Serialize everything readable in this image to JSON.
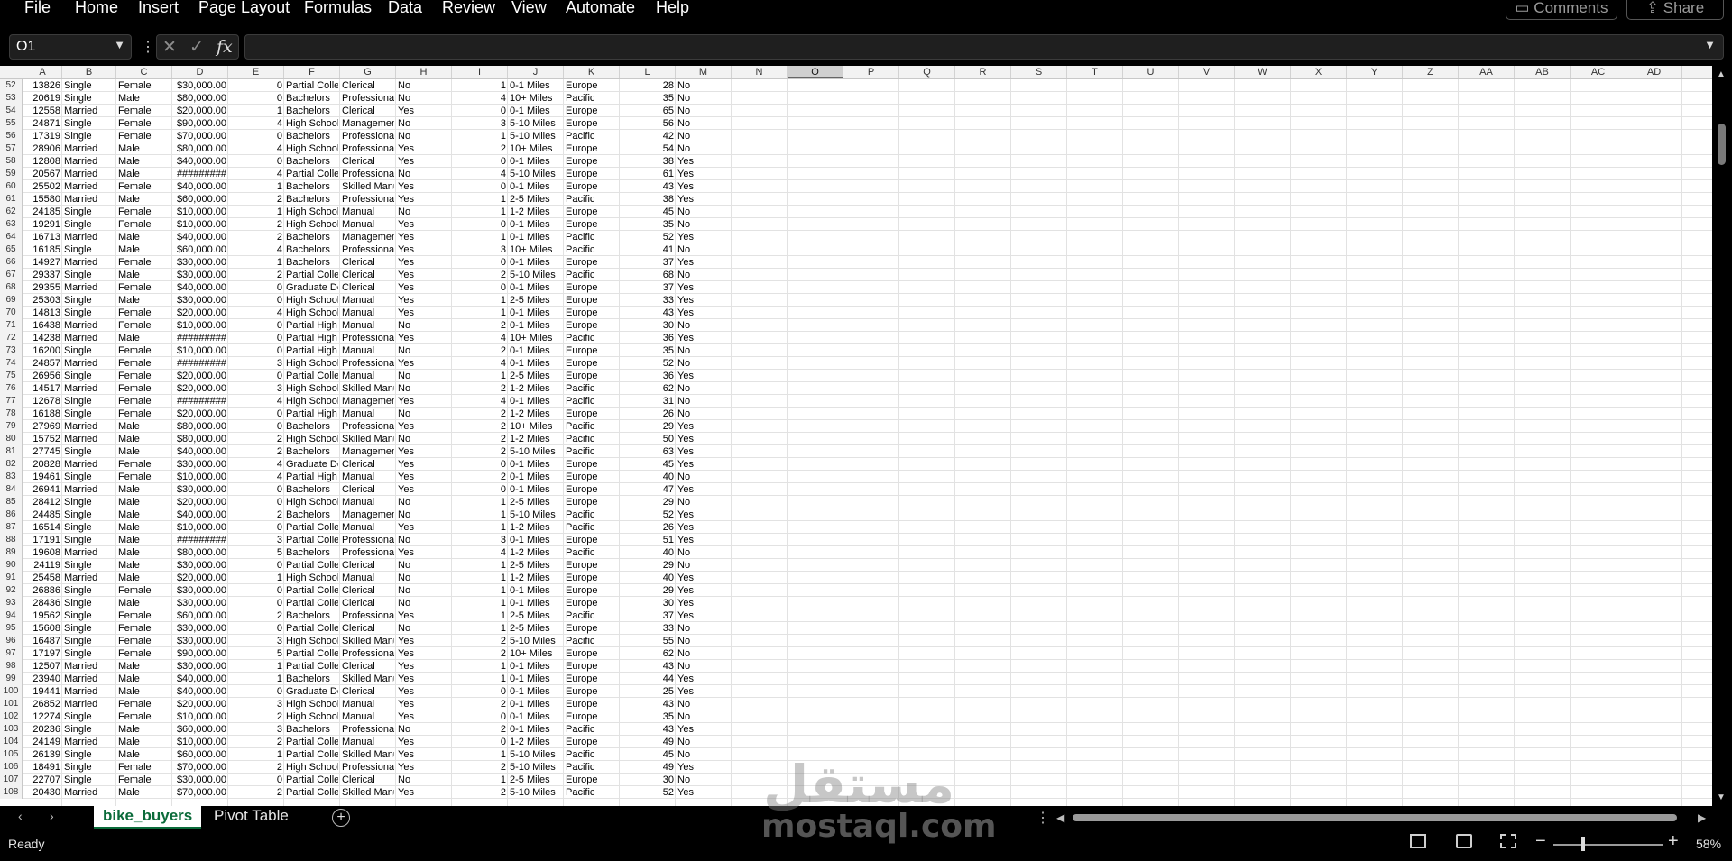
{
  "menu": [
    "File",
    "Home",
    "Insert",
    "Page Layout",
    "Formulas",
    "Data",
    "Review",
    "View",
    "Automate",
    "Help"
  ],
  "top_buttons": {
    "comments": "Comments",
    "share": "Share"
  },
  "formula_bar": {
    "name_box": "O1",
    "fx": "fx",
    "cancel": "✕",
    "enter": "✓",
    "more": "⋮",
    "value": ""
  },
  "columns": [
    "A",
    "B",
    "C",
    "D",
    "E",
    "F",
    "G",
    "H",
    "I",
    "J",
    "K",
    "L",
    "M",
    "N",
    "O",
    "P",
    "Q",
    "R",
    "S",
    "T",
    "U",
    "V",
    "W",
    "X",
    "Y",
    "Z",
    "AA",
    "AB",
    "AC",
    "AD"
  ],
  "selected_column": "O",
  "rows": [
    {
      "n": "52",
      "a": "13826",
      "b": "Single",
      "c": "Female",
      "d": "$30,000.00",
      "e": "0",
      "f": "Partial College",
      "g": "Clerical",
      "h": "No",
      "i": "1",
      "j": "0-1 Miles",
      "k": "Europe",
      "l": "28",
      "m": "No"
    },
    {
      "n": "53",
      "a": "20619",
      "b": "Single",
      "c": "Male",
      "d": "$80,000.00",
      "e": "0",
      "f": "Bachelors",
      "g": "Professional",
      "h": "No",
      "i": "4",
      "j": "10+ Miles",
      "k": "Pacific",
      "l": "35",
      "m": "No"
    },
    {
      "n": "54",
      "a": "12558",
      "b": "Married",
      "c": "Female",
      "d": "$20,000.00",
      "e": "1",
      "f": "Bachelors",
      "g": "Clerical",
      "h": "Yes",
      "i": "0",
      "j": "0-1 Miles",
      "k": "Europe",
      "l": "65",
      "m": "No"
    },
    {
      "n": "55",
      "a": "24871",
      "b": "Single",
      "c": "Female",
      "d": "$90,000.00",
      "e": "4",
      "f": "High School",
      "g": "Management",
      "h": "No",
      "i": "3",
      "j": "5-10 Miles",
      "k": "Europe",
      "l": "56",
      "m": "No"
    },
    {
      "n": "56",
      "a": "17319",
      "b": "Single",
      "c": "Female",
      "d": "$70,000.00",
      "e": "0",
      "f": "Bachelors",
      "g": "Professional",
      "h": "No",
      "i": "1",
      "j": "5-10 Miles",
      "k": "Pacific",
      "l": "42",
      "m": "No"
    },
    {
      "n": "57",
      "a": "28906",
      "b": "Married",
      "c": "Male",
      "d": "$80,000.00",
      "e": "4",
      "f": "High School",
      "g": "Professional",
      "h": "Yes",
      "i": "2",
      "j": "10+ Miles",
      "k": "Europe",
      "l": "54",
      "m": "No"
    },
    {
      "n": "58",
      "a": "12808",
      "b": "Married",
      "c": "Male",
      "d": "$40,000.00",
      "e": "0",
      "f": "Bachelors",
      "g": "Clerical",
      "h": "Yes",
      "i": "0",
      "j": "0-1 Miles",
      "k": "Europe",
      "l": "38",
      "m": "Yes"
    },
    {
      "n": "59",
      "a": "20567",
      "b": "Married",
      "c": "Male",
      "d": "#########",
      "e": "4",
      "f": "Partial College",
      "g": "Professional",
      "h": "No",
      "i": "4",
      "j": "5-10 Miles",
      "k": "Europe",
      "l": "61",
      "m": "Yes"
    },
    {
      "n": "60",
      "a": "25502",
      "b": "Married",
      "c": "Female",
      "d": "$40,000.00",
      "e": "1",
      "f": "Bachelors",
      "g": "Skilled Manual",
      "h": "Yes",
      "i": "0",
      "j": "0-1 Miles",
      "k": "Europe",
      "l": "43",
      "m": "Yes"
    },
    {
      "n": "61",
      "a": "15580",
      "b": "Married",
      "c": "Male",
      "d": "$60,000.00",
      "e": "2",
      "f": "Bachelors",
      "g": "Professional",
      "h": "Yes",
      "i": "1",
      "j": "2-5 Miles",
      "k": "Pacific",
      "l": "38",
      "m": "Yes"
    },
    {
      "n": "62",
      "a": "24185",
      "b": "Single",
      "c": "Female",
      "d": "$10,000.00",
      "e": "1",
      "f": "High School",
      "g": "Manual",
      "h": "No",
      "i": "1",
      "j": "1-2 Miles",
      "k": "Europe",
      "l": "45",
      "m": "No"
    },
    {
      "n": "63",
      "a": "19291",
      "b": "Single",
      "c": "Female",
      "d": "$10,000.00",
      "e": "2",
      "f": "High School",
      "g": "Manual",
      "h": "Yes",
      "i": "0",
      "j": "0-1 Miles",
      "k": "Europe",
      "l": "35",
      "m": "No"
    },
    {
      "n": "64",
      "a": "16713",
      "b": "Married",
      "c": "Male",
      "d": "$40,000.00",
      "e": "2",
      "f": "Bachelors",
      "g": "Management",
      "h": "Yes",
      "i": "1",
      "j": "0-1 Miles",
      "k": "Pacific",
      "l": "52",
      "m": "Yes"
    },
    {
      "n": "65",
      "a": "16185",
      "b": "Single",
      "c": "Male",
      "d": "$60,000.00",
      "e": "4",
      "f": "Bachelors",
      "g": "Professional",
      "h": "Yes",
      "i": "3",
      "j": "10+ Miles",
      "k": "Pacific",
      "l": "41",
      "m": "No"
    },
    {
      "n": "66",
      "a": "14927",
      "b": "Married",
      "c": "Female",
      "d": "$30,000.00",
      "e": "1",
      "f": "Bachelors",
      "g": "Clerical",
      "h": "Yes",
      "i": "0",
      "j": "0-1 Miles",
      "k": "Europe",
      "l": "37",
      "m": "Yes"
    },
    {
      "n": "67",
      "a": "29337",
      "b": "Single",
      "c": "Male",
      "d": "$30,000.00",
      "e": "2",
      "f": "Partial College",
      "g": "Clerical",
      "h": "Yes",
      "i": "2",
      "j": "5-10 Miles",
      "k": "Pacific",
      "l": "68",
      "m": "No"
    },
    {
      "n": "68",
      "a": "29355",
      "b": "Married",
      "c": "Female",
      "d": "$40,000.00",
      "e": "0",
      "f": "Graduate Degree",
      "g": "Clerical",
      "h": "Yes",
      "i": "0",
      "j": "0-1 Miles",
      "k": "Europe",
      "l": "37",
      "m": "Yes"
    },
    {
      "n": "69",
      "a": "25303",
      "b": "Single",
      "c": "Male",
      "d": "$30,000.00",
      "e": "0",
      "f": "High School",
      "g": "Manual",
      "h": "Yes",
      "i": "1",
      "j": "2-5 Miles",
      "k": "Europe",
      "l": "33",
      "m": "Yes"
    },
    {
      "n": "70",
      "a": "14813",
      "b": "Single",
      "c": "Female",
      "d": "$20,000.00",
      "e": "4",
      "f": "High School",
      "g": "Manual",
      "h": "Yes",
      "i": "1",
      "j": "0-1 Miles",
      "k": "Europe",
      "l": "43",
      "m": "Yes"
    },
    {
      "n": "71",
      "a": "16438",
      "b": "Married",
      "c": "Female",
      "d": "$10,000.00",
      "e": "0",
      "f": "Partial High School",
      "g": "Manual",
      "h": "No",
      "i": "2",
      "j": "0-1 Miles",
      "k": "Europe",
      "l": "30",
      "m": "No"
    },
    {
      "n": "72",
      "a": "14238",
      "b": "Married",
      "c": "Male",
      "d": "#########",
      "e": "0",
      "f": "Partial High School",
      "g": "Professional",
      "h": "Yes",
      "i": "4",
      "j": "10+ Miles",
      "k": "Pacific",
      "l": "36",
      "m": "Yes"
    },
    {
      "n": "73",
      "a": "16200",
      "b": "Single",
      "c": "Female",
      "d": "$10,000.00",
      "e": "0",
      "f": "Partial High School",
      "g": "Manual",
      "h": "No",
      "i": "2",
      "j": "0-1 Miles",
      "k": "Europe",
      "l": "35",
      "m": "No"
    },
    {
      "n": "74",
      "a": "24857",
      "b": "Married",
      "c": "Female",
      "d": "#########",
      "e": "3",
      "f": "High School",
      "g": "Professional",
      "h": "Yes",
      "i": "4",
      "j": "0-1 Miles",
      "k": "Europe",
      "l": "52",
      "m": "No"
    },
    {
      "n": "75",
      "a": "26956",
      "b": "Single",
      "c": "Female",
      "d": "$20,000.00",
      "e": "0",
      "f": "Partial College",
      "g": "Manual",
      "h": "No",
      "i": "1",
      "j": "2-5 Miles",
      "k": "Europe",
      "l": "36",
      "m": "Yes"
    },
    {
      "n": "76",
      "a": "14517",
      "b": "Married",
      "c": "Female",
      "d": "$20,000.00",
      "e": "3",
      "f": "High School",
      "g": "Skilled Manual",
      "h": "No",
      "i": "2",
      "j": "1-2 Miles",
      "k": "Pacific",
      "l": "62",
      "m": "No"
    },
    {
      "n": "77",
      "a": "12678",
      "b": "Single",
      "c": "Female",
      "d": "#########",
      "e": "4",
      "f": "High School",
      "g": "Management",
      "h": "Yes",
      "i": "4",
      "j": "0-1 Miles",
      "k": "Pacific",
      "l": "31",
      "m": "No"
    },
    {
      "n": "78",
      "a": "16188",
      "b": "Single",
      "c": "Female",
      "d": "$20,000.00",
      "e": "0",
      "f": "Partial High School",
      "g": "Manual",
      "h": "No",
      "i": "2",
      "j": "1-2 Miles",
      "k": "Europe",
      "l": "26",
      "m": "No"
    },
    {
      "n": "79",
      "a": "27969",
      "b": "Married",
      "c": "Male",
      "d": "$80,000.00",
      "e": "0",
      "f": "Bachelors",
      "g": "Professional",
      "h": "Yes",
      "i": "2",
      "j": "10+ Miles",
      "k": "Pacific",
      "l": "29",
      "m": "Yes"
    },
    {
      "n": "80",
      "a": "15752",
      "b": "Married",
      "c": "Male",
      "d": "$80,000.00",
      "e": "2",
      "f": "High School",
      "g": "Skilled Manual",
      "h": "No",
      "i": "2",
      "j": "1-2 Miles",
      "k": "Pacific",
      "l": "50",
      "m": "Yes"
    },
    {
      "n": "81",
      "a": "27745",
      "b": "Single",
      "c": "Male",
      "d": "$40,000.00",
      "e": "2",
      "f": "Bachelors",
      "g": "Management",
      "h": "Yes",
      "i": "2",
      "j": "5-10 Miles",
      "k": "Pacific",
      "l": "63",
      "m": "Yes"
    },
    {
      "n": "82",
      "a": "20828",
      "b": "Married",
      "c": "Female",
      "d": "$30,000.00",
      "e": "4",
      "f": "Graduate Degree",
      "g": "Clerical",
      "h": "Yes",
      "i": "0",
      "j": "0-1 Miles",
      "k": "Europe",
      "l": "45",
      "m": "Yes"
    },
    {
      "n": "83",
      "a": "19461",
      "b": "Single",
      "c": "Female",
      "d": "$10,000.00",
      "e": "4",
      "f": "Partial High School",
      "g": "Manual",
      "h": "Yes",
      "i": "2",
      "j": "0-1 Miles",
      "k": "Europe",
      "l": "40",
      "m": "No"
    },
    {
      "n": "84",
      "a": "26941",
      "b": "Married",
      "c": "Male",
      "d": "$30,000.00",
      "e": "0",
      "f": "Bachelors",
      "g": "Clerical",
      "h": "Yes",
      "i": "0",
      "j": "0-1 Miles",
      "k": "Europe",
      "l": "47",
      "m": "Yes"
    },
    {
      "n": "85",
      "a": "28412",
      "b": "Single",
      "c": "Male",
      "d": "$20,000.00",
      "e": "0",
      "f": "High School",
      "g": "Manual",
      "h": "No",
      "i": "1",
      "j": "2-5 Miles",
      "k": "Europe",
      "l": "29",
      "m": "No"
    },
    {
      "n": "86",
      "a": "24485",
      "b": "Single",
      "c": "Male",
      "d": "$40,000.00",
      "e": "2",
      "f": "Bachelors",
      "g": "Management",
      "h": "No",
      "i": "1",
      "j": "5-10 Miles",
      "k": "Pacific",
      "l": "52",
      "m": "Yes"
    },
    {
      "n": "87",
      "a": "16514",
      "b": "Single",
      "c": "Male",
      "d": "$10,000.00",
      "e": "0",
      "f": "Partial College",
      "g": "Manual",
      "h": "Yes",
      "i": "1",
      "j": "1-2 Miles",
      "k": "Pacific",
      "l": "26",
      "m": "Yes"
    },
    {
      "n": "88",
      "a": "17191",
      "b": "Single",
      "c": "Male",
      "d": "#########",
      "e": "3",
      "f": "Partial College",
      "g": "Professional",
      "h": "No",
      "i": "3",
      "j": "0-1 Miles",
      "k": "Europe",
      "l": "51",
      "m": "Yes"
    },
    {
      "n": "89",
      "a": "19608",
      "b": "Married",
      "c": "Male",
      "d": "$80,000.00",
      "e": "5",
      "f": "Bachelors",
      "g": "Professional",
      "h": "Yes",
      "i": "4",
      "j": "1-2 Miles",
      "k": "Pacific",
      "l": "40",
      "m": "No"
    },
    {
      "n": "90",
      "a": "24119",
      "b": "Single",
      "c": "Male",
      "d": "$30,000.00",
      "e": "0",
      "f": "Partial College",
      "g": "Clerical",
      "h": "No",
      "i": "1",
      "j": "2-5 Miles",
      "k": "Europe",
      "l": "29",
      "m": "No"
    },
    {
      "n": "91",
      "a": "25458",
      "b": "Married",
      "c": "Male",
      "d": "$20,000.00",
      "e": "1",
      "f": "High School",
      "g": "Manual",
      "h": "No",
      "i": "1",
      "j": "1-2 Miles",
      "k": "Europe",
      "l": "40",
      "m": "Yes"
    },
    {
      "n": "92",
      "a": "26886",
      "b": "Single",
      "c": "Female",
      "d": "$30,000.00",
      "e": "0",
      "f": "Partial College",
      "g": "Clerical",
      "h": "No",
      "i": "1",
      "j": "0-1 Miles",
      "k": "Europe",
      "l": "29",
      "m": "Yes"
    },
    {
      "n": "93",
      "a": "28436",
      "b": "Single",
      "c": "Male",
      "d": "$30,000.00",
      "e": "0",
      "f": "Partial College",
      "g": "Clerical",
      "h": "No",
      "i": "1",
      "j": "0-1 Miles",
      "k": "Europe",
      "l": "30",
      "m": "Yes"
    },
    {
      "n": "94",
      "a": "19562",
      "b": "Single",
      "c": "Female",
      "d": "$60,000.00",
      "e": "2",
      "f": "Bachelors",
      "g": "Professional",
      "h": "Yes",
      "i": "1",
      "j": "2-5 Miles",
      "k": "Pacific",
      "l": "37",
      "m": "Yes"
    },
    {
      "n": "95",
      "a": "15608",
      "b": "Single",
      "c": "Female",
      "d": "$30,000.00",
      "e": "0",
      "f": "Partial College",
      "g": "Clerical",
      "h": "No",
      "i": "1",
      "j": "2-5 Miles",
      "k": "Europe",
      "l": "33",
      "m": "No"
    },
    {
      "n": "96",
      "a": "16487",
      "b": "Single",
      "c": "Female",
      "d": "$30,000.00",
      "e": "3",
      "f": "High School",
      "g": "Skilled Manual",
      "h": "Yes",
      "i": "2",
      "j": "5-10 Miles",
      "k": "Pacific",
      "l": "55",
      "m": "No"
    },
    {
      "n": "97",
      "a": "17197",
      "b": "Single",
      "c": "Female",
      "d": "$90,000.00",
      "e": "5",
      "f": "Partial College",
      "g": "Professional",
      "h": "Yes",
      "i": "2",
      "j": "10+ Miles",
      "k": "Europe",
      "l": "62",
      "m": "No"
    },
    {
      "n": "98",
      "a": "12507",
      "b": "Married",
      "c": "Male",
      "d": "$30,000.00",
      "e": "1",
      "f": "Partial College",
      "g": "Clerical",
      "h": "Yes",
      "i": "1",
      "j": "0-1 Miles",
      "k": "Europe",
      "l": "43",
      "m": "No"
    },
    {
      "n": "99",
      "a": "23940",
      "b": "Married",
      "c": "Male",
      "d": "$40,000.00",
      "e": "1",
      "f": "Bachelors",
      "g": "Skilled Manual",
      "h": "Yes",
      "i": "1",
      "j": "0-1 Miles",
      "k": "Europe",
      "l": "44",
      "m": "Yes"
    },
    {
      "n": "100",
      "a": "19441",
      "b": "Married",
      "c": "Male",
      "d": "$40,000.00",
      "e": "0",
      "f": "Graduate Degree",
      "g": "Clerical",
      "h": "Yes",
      "i": "0",
      "j": "0-1 Miles",
      "k": "Europe",
      "l": "25",
      "m": "Yes"
    },
    {
      "n": "101",
      "a": "26852",
      "b": "Married",
      "c": "Female",
      "d": "$20,000.00",
      "e": "3",
      "f": "High School",
      "g": "Manual",
      "h": "Yes",
      "i": "2",
      "j": "0-1 Miles",
      "k": "Europe",
      "l": "43",
      "m": "No"
    },
    {
      "n": "102",
      "a": "12274",
      "b": "Single",
      "c": "Female",
      "d": "$10,000.00",
      "e": "2",
      "f": "High School",
      "g": "Manual",
      "h": "Yes",
      "i": "0",
      "j": "0-1 Miles",
      "k": "Europe",
      "l": "35",
      "m": "No"
    },
    {
      "n": "103",
      "a": "20236",
      "b": "Single",
      "c": "Male",
      "d": "$60,000.00",
      "e": "3",
      "f": "Bachelors",
      "g": "Professional",
      "h": "No",
      "i": "2",
      "j": "0-1 Miles",
      "k": "Pacific",
      "l": "43",
      "m": "Yes"
    },
    {
      "n": "104",
      "a": "24149",
      "b": "Married",
      "c": "Male",
      "d": "$10,000.00",
      "e": "2",
      "f": "Partial College",
      "g": "Manual",
      "h": "Yes",
      "i": "0",
      "j": "1-2 Miles",
      "k": "Europe",
      "l": "49",
      "m": "No"
    },
    {
      "n": "105",
      "a": "26139",
      "b": "Single",
      "c": "Male",
      "d": "$60,000.00",
      "e": "1",
      "f": "Partial College",
      "g": "Skilled Manual",
      "h": "Yes",
      "i": "1",
      "j": "5-10 Miles",
      "k": "Pacific",
      "l": "45",
      "m": "No"
    },
    {
      "n": "106",
      "a": "18491",
      "b": "Single",
      "c": "Female",
      "d": "$70,000.00",
      "e": "2",
      "f": "High School",
      "g": "Professional",
      "h": "Yes",
      "i": "2",
      "j": "5-10 Miles",
      "k": "Pacific",
      "l": "49",
      "m": "Yes"
    },
    {
      "n": "107",
      "a": "22707",
      "b": "Single",
      "c": "Female",
      "d": "$30,000.00",
      "e": "0",
      "f": "Partial College",
      "g": "Clerical",
      "h": "No",
      "i": "1",
      "j": "2-5 Miles",
      "k": "Europe",
      "l": "30",
      "m": "No"
    },
    {
      "n": "108",
      "a": "20430",
      "b": "Married",
      "c": "Male",
      "d": "$70,000.00",
      "e": "2",
      "f": "Partial College",
      "g": "Skilled Manual",
      "h": "Yes",
      "i": "2",
      "j": "5-10 Miles",
      "k": "Pacific",
      "l": "52",
      "m": "Yes"
    }
  ],
  "sheet_tabs": [
    "bike_buyers",
    "Pivot Table"
  ],
  "active_sheet": "bike_buyers",
  "add_sheet_label": "+",
  "status": {
    "ready": "Ready",
    "zoom": "58%",
    "zoom_level_fraction": 0.58,
    "zoom_minus": "−",
    "zoom_plus": "+"
  },
  "watermark": {
    "arabic": "مستقل",
    "latin": "mostaql.com"
  }
}
